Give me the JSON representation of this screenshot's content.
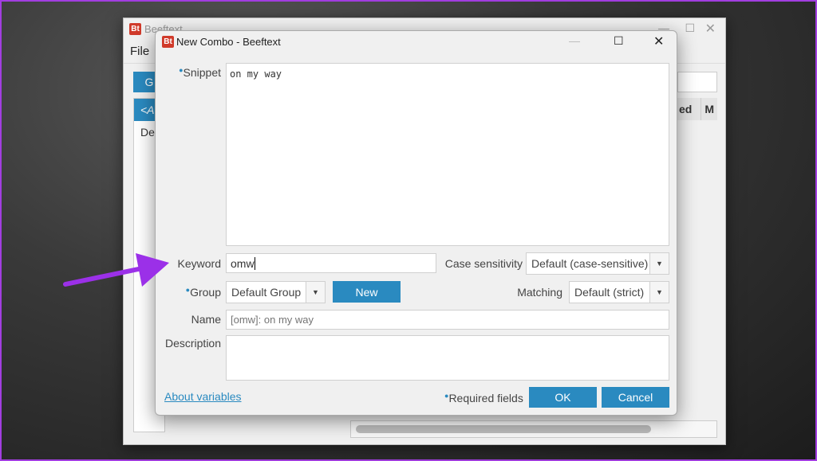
{
  "background_window": {
    "title": "Beeftext",
    "menu_file": "File",
    "btn_fragment": "G",
    "list_header_fragment": "<A",
    "list_item_fragment": "De",
    "col_fragment_1": "ed",
    "col_fragment_2": "M"
  },
  "dialog": {
    "app_icon": "Bt",
    "title": "New Combo - Beeftext",
    "snippet_label": "Snippet",
    "snippet_value": "on my way",
    "keyword_label": "Keyword",
    "keyword_value": "omw",
    "case_label": "Case sensitivity",
    "case_value": "Default (case-sensitive)",
    "group_label": "Group",
    "group_value": "Default Group",
    "new_label": "New",
    "matching_label": "Matching",
    "matching_value": "Default (strict)",
    "name_label": "Name",
    "name_placeholder": "[omw]: on my way",
    "description_label": "Description",
    "description_value": "",
    "about_link": "About variables",
    "required_label": "Required fields",
    "ok_label": "OK",
    "cancel_label": "Cancel"
  },
  "colors": {
    "accent": "#2a8ac0",
    "arrow": "#9b30e8",
    "logo": "#d03a2a"
  }
}
